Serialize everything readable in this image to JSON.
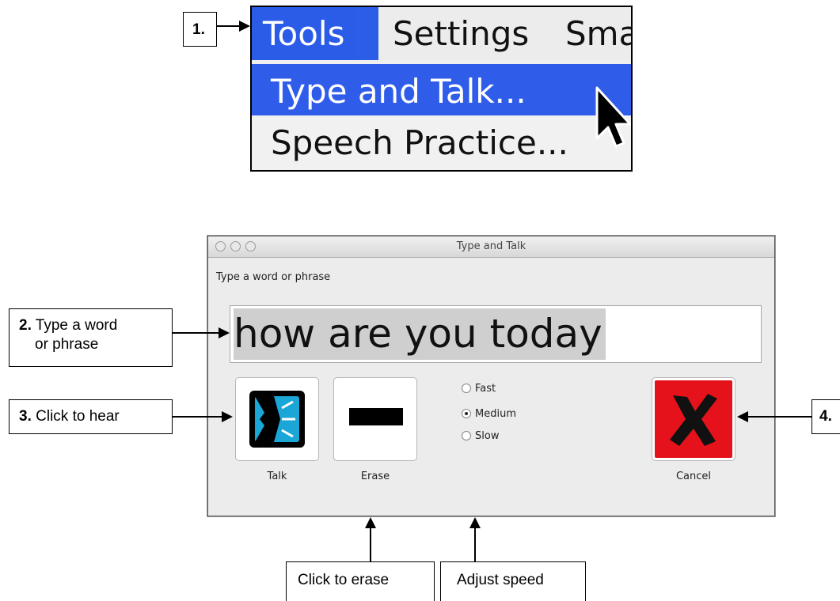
{
  "menu": {
    "bar_items": [
      "Tools",
      "Settings",
      "Sma"
    ],
    "dropdown_items": [
      "Type and Talk...",
      "Speech Practice..."
    ]
  },
  "dialog": {
    "title": "Type and Talk",
    "prompt": "Type a word or phrase",
    "phrase_value": "how are you today",
    "buttons": {
      "talk": "Talk",
      "erase": "Erase",
      "cancel": "Cancel"
    },
    "speed_options": [
      {
        "label": "Fast",
        "selected": false
      },
      {
        "label": "Medium",
        "selected": true
      },
      {
        "label": "Slow",
        "selected": false
      }
    ]
  },
  "callouts": {
    "c1": {
      "num": "1."
    },
    "c2": {
      "num": "2.",
      "text_line1": "Type a word",
      "text_line2": "or phrase"
    },
    "c3": {
      "num": "3.",
      "text": "Click to hear"
    },
    "c4": {
      "num": "4."
    },
    "erase": {
      "text": "Click to erase"
    },
    "speed": {
      "text": "Adjust speed"
    }
  },
  "colors": {
    "menu_highlight": "#2b5de6",
    "talk_icon": "#1aa6d6",
    "cancel_bg": "#e5121b"
  }
}
